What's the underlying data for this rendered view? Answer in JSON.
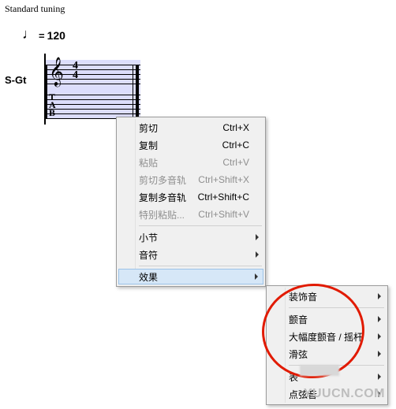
{
  "tuning_label": "Standard tuning",
  "tempo": {
    "note_glyph": "♩",
    "eq": "=",
    "bpm": "120"
  },
  "track_label": "S-Gt",
  "notation": {
    "clef_glyph": "𝄞",
    "timesig_top": "4",
    "timesig_bot": "4",
    "tab": "T\nA\nB"
  },
  "menu": {
    "items": [
      {
        "label": "剪切",
        "shortcut": "Ctrl+X",
        "disabled": false,
        "submenu": false,
        "sep": false
      },
      {
        "label": "复制",
        "shortcut": "Ctrl+C",
        "disabled": false,
        "submenu": false,
        "sep": false
      },
      {
        "label": "粘贴",
        "shortcut": "Ctrl+V",
        "disabled": true,
        "submenu": false,
        "sep": false
      },
      {
        "label": "剪切多音轨",
        "shortcut": "Ctrl+Shift+X",
        "disabled": true,
        "submenu": false,
        "sep": false
      },
      {
        "label": "复制多音轨",
        "shortcut": "Ctrl+Shift+C",
        "disabled": false,
        "submenu": false,
        "sep": false
      },
      {
        "label": "特别粘贴...",
        "shortcut": "Ctrl+Shift+V",
        "disabled": true,
        "submenu": false,
        "sep": true
      },
      {
        "label": "小节",
        "shortcut": "",
        "disabled": false,
        "submenu": true,
        "sep": false
      },
      {
        "label": "音符",
        "shortcut": "",
        "disabled": false,
        "submenu": true,
        "sep": true
      },
      {
        "label": "效果",
        "shortcut": "",
        "disabled": false,
        "submenu": true,
        "sep": false,
        "highlight": true
      }
    ]
  },
  "submenu": {
    "items": [
      {
        "label": "装饰音",
        "submenu": true,
        "sep": true
      },
      {
        "label": "颤音",
        "submenu": true,
        "sep": false
      },
      {
        "label": "大幅度颤音 / 摇杆",
        "submenu": true,
        "sep": false
      },
      {
        "label": "滑弦",
        "submenu": true,
        "sep": true
      },
      {
        "label": "表",
        "submenu": true,
        "sep": false
      },
      {
        "label": "点弦音",
        "submenu": true,
        "sep": false
      }
    ]
  },
  "watermark": "YUUCN.COM"
}
